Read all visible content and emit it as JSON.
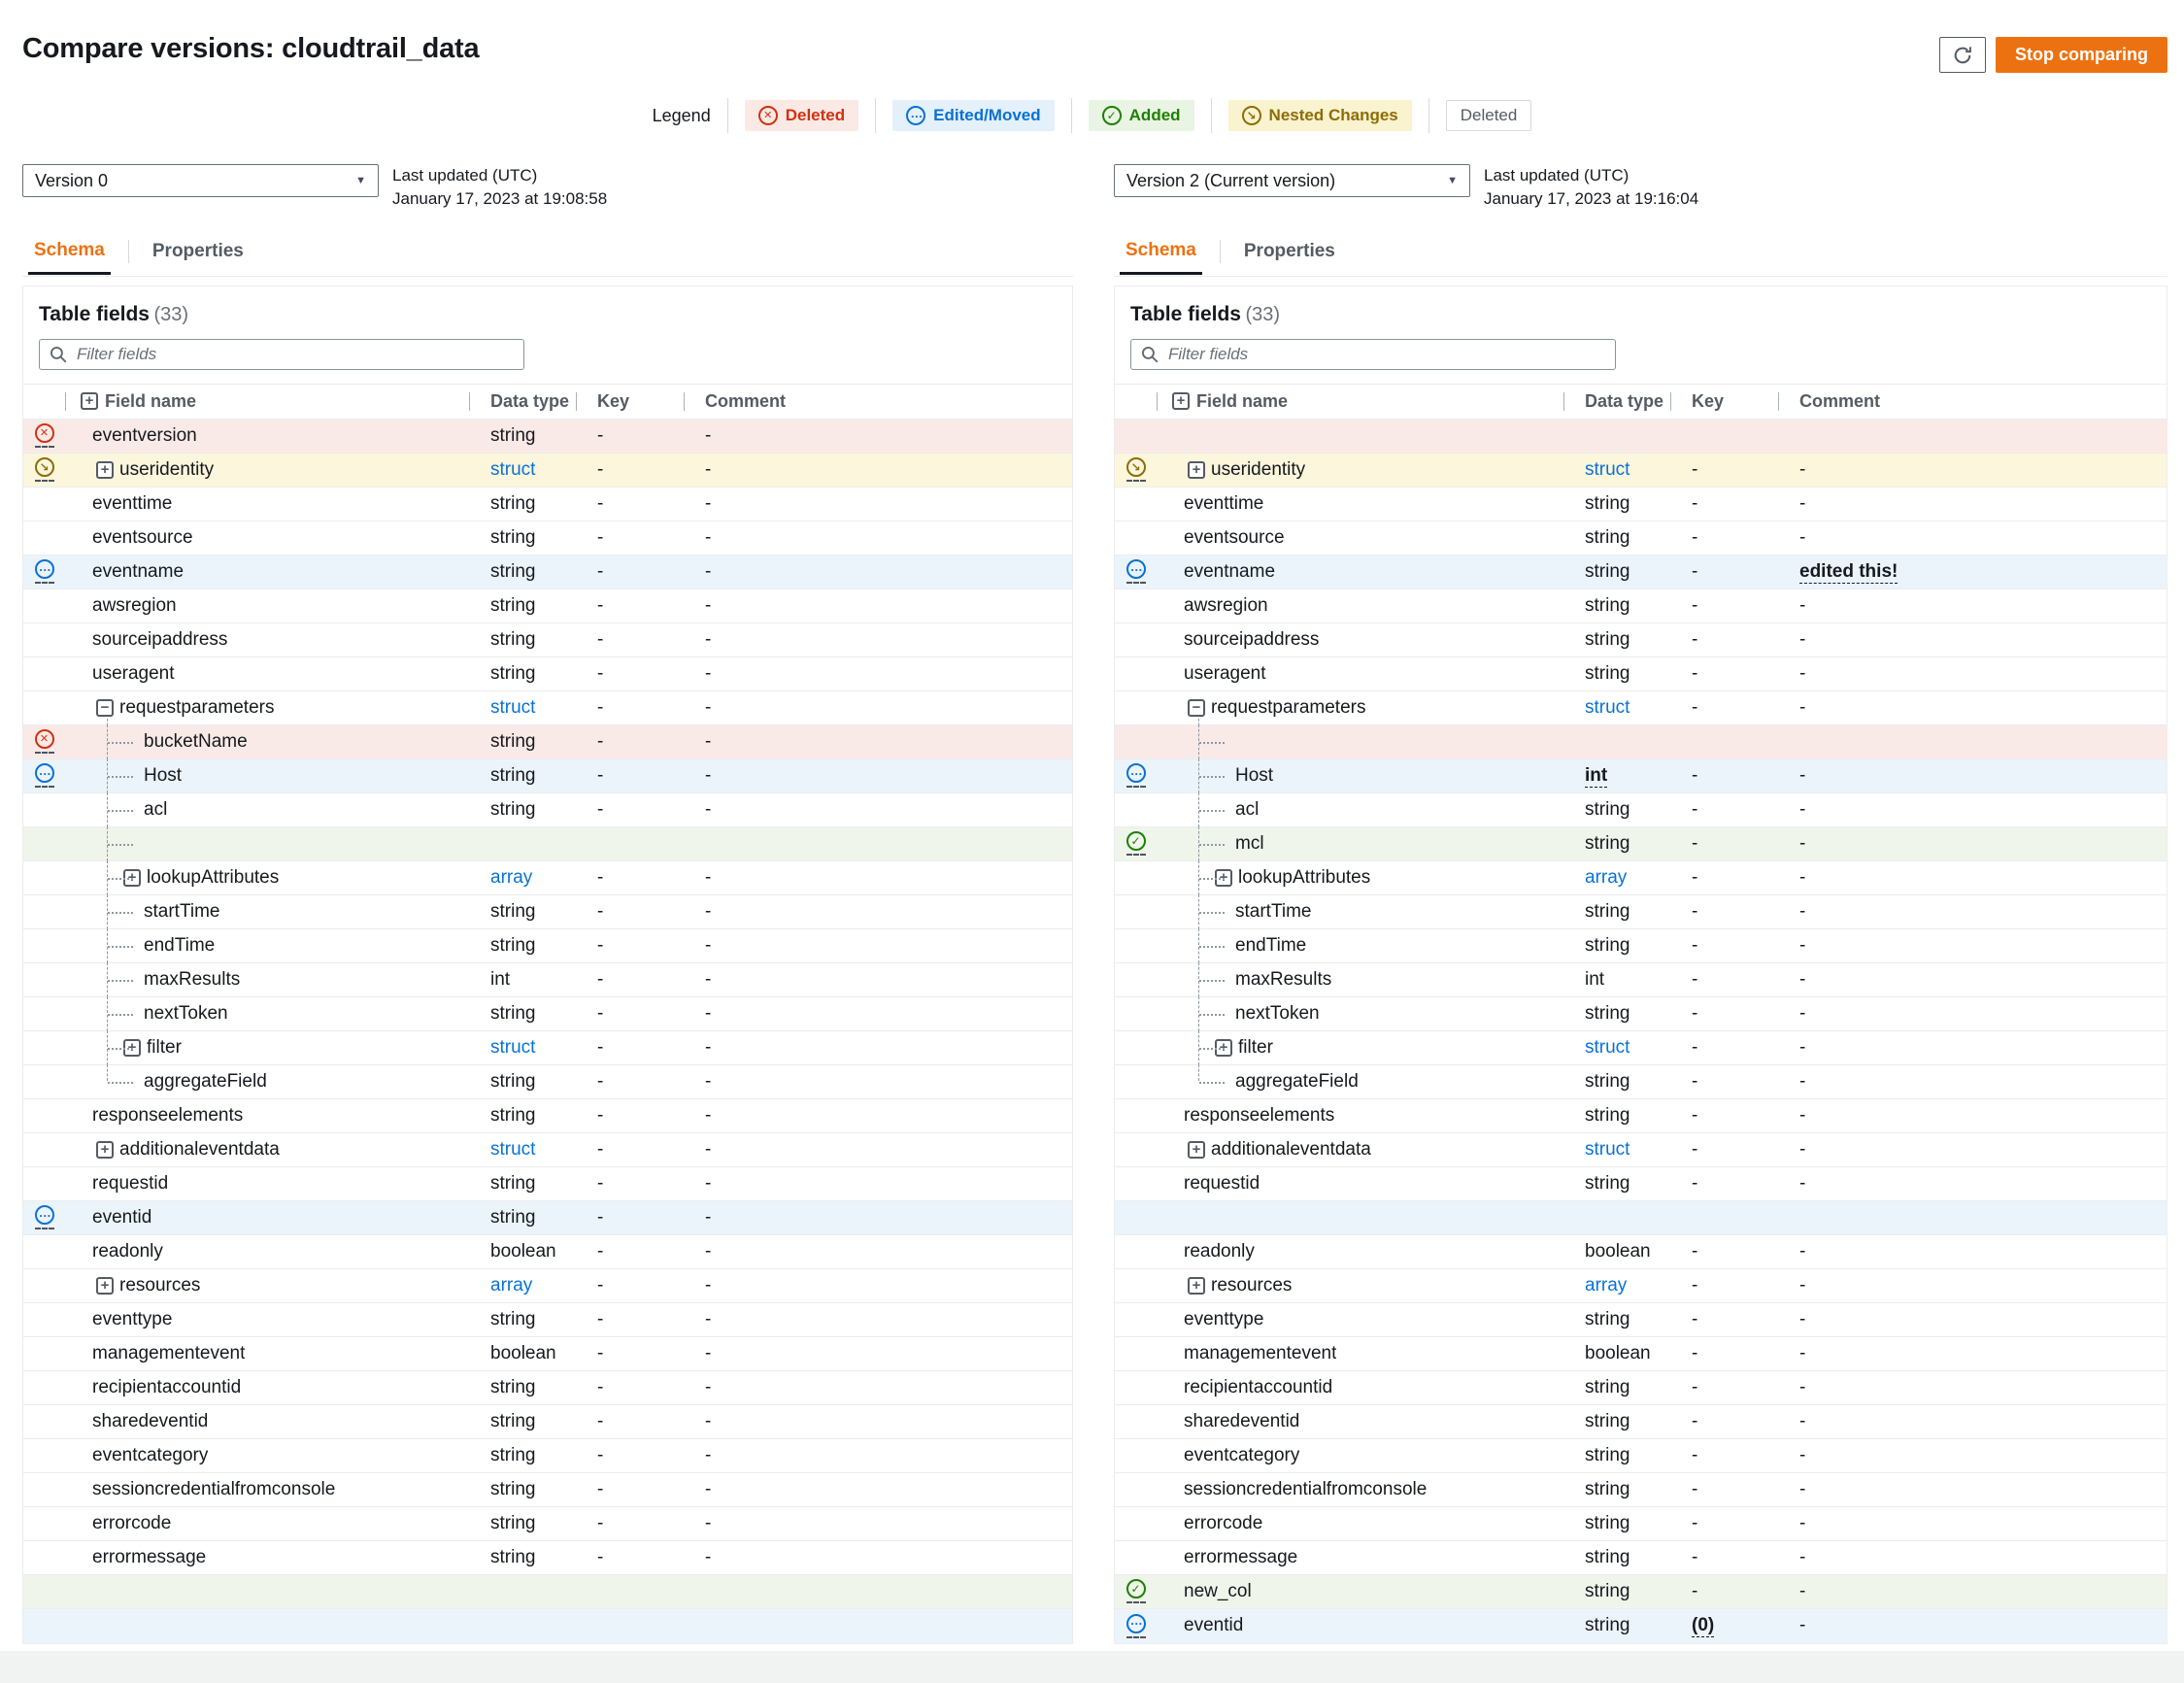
{
  "header": {
    "title": "Compare versions: cloudtrail_data",
    "refresh_icon": "refresh-icon",
    "stop_label": "Stop comparing"
  },
  "legend": {
    "label": "Legend",
    "items": [
      {
        "label": "Deleted",
        "type": "deleted"
      },
      {
        "label": "Edited/Moved",
        "type": "edited"
      },
      {
        "label": "Added",
        "type": "added"
      },
      {
        "label": "Nested Changes",
        "type": "nested"
      },
      {
        "label": "Deleted",
        "type": "plain"
      }
    ]
  },
  "status_colors": {
    "deleted": "#d13212",
    "edited": "#0972d3",
    "added": "#1d8102",
    "nested": "#8f6c08",
    "accent_orange": "#ec7211",
    "link_blue": "#0972d3"
  },
  "panels": [
    {
      "version": "Version 0",
      "last_updated_label": "Last updated (UTC)",
      "last_updated": "January 17, 2023 at 19:08:58",
      "tabs": [
        {
          "label": "Schema",
          "active": true
        },
        {
          "label": "Properties",
          "active": false
        }
      ],
      "table_title": "Table fields",
      "table_count": "(33)",
      "filter_placeholder": "Filter fields",
      "columns": [
        "Field name",
        "Data type",
        "Key",
        "Comment"
      ],
      "rows": [
        {
          "name": "eventversion",
          "type": "string",
          "key": "-",
          "comment": "-",
          "status": "deleted",
          "level": 0
        },
        {
          "name": "useridentity",
          "type": "struct",
          "key": "-",
          "comment": "-",
          "status": "nested",
          "level": 0,
          "expand": "plus"
        },
        {
          "name": "eventtime",
          "type": "string",
          "key": "-",
          "comment": "-",
          "level": 0
        },
        {
          "name": "eventsource",
          "type": "string",
          "key": "-",
          "comment": "-",
          "level": 0
        },
        {
          "name": "eventname",
          "type": "string",
          "key": "-",
          "comment": "-",
          "status": "edited",
          "level": 0
        },
        {
          "name": "awsregion",
          "type": "string",
          "key": "-",
          "comment": "-",
          "level": 0
        },
        {
          "name": "sourceipaddress",
          "type": "string",
          "key": "-",
          "comment": "-",
          "level": 0
        },
        {
          "name": "useragent",
          "type": "string",
          "key": "-",
          "comment": "-",
          "level": 0
        },
        {
          "name": "requestparameters",
          "type": "struct",
          "key": "-",
          "comment": "-",
          "level": 0,
          "expand": "minus"
        },
        {
          "name": "bucketName",
          "type": "string",
          "key": "-",
          "comment": "-",
          "status": "deleted",
          "level": 1
        },
        {
          "name": "Host",
          "type": "string",
          "key": "-",
          "comment": "-",
          "status": "edited",
          "level": 1
        },
        {
          "name": "acl",
          "type": "string",
          "key": "-",
          "comment": "-",
          "level": 1
        },
        {
          "empty": true,
          "status": "added",
          "level": 1
        },
        {
          "name": "lookupAttributes",
          "type": "array",
          "key": "-",
          "comment": "-",
          "level": 1,
          "expand": "plus"
        },
        {
          "name": "startTime",
          "type": "string",
          "key": "-",
          "comment": "-",
          "level": 1
        },
        {
          "name": "endTime",
          "type": "string",
          "key": "-",
          "comment": "-",
          "level": 1
        },
        {
          "name": "maxResults",
          "type": "int",
          "key": "-",
          "comment": "-",
          "level": 1
        },
        {
          "name": "nextToken",
          "type": "string",
          "key": "-",
          "comment": "-",
          "level": 1
        },
        {
          "name": "filter",
          "type": "struct",
          "key": "-",
          "comment": "-",
          "level": 1,
          "expand": "plus"
        },
        {
          "name": "aggregateField",
          "type": "string",
          "key": "-",
          "comment": "-",
          "level": 1
        },
        {
          "name": "responseelements",
          "type": "string",
          "key": "-",
          "comment": "-",
          "level": 0
        },
        {
          "name": "additionaleventdata",
          "type": "struct",
          "key": "-",
          "comment": "-",
          "level": 0,
          "expand": "plus"
        },
        {
          "name": "requestid",
          "type": "string",
          "key": "-",
          "comment": "-",
          "level": 0
        },
        {
          "name": "eventid",
          "type": "string",
          "key": "-",
          "comment": "-",
          "status": "edited",
          "level": 0
        },
        {
          "name": "readonly",
          "type": "boolean",
          "key": "-",
          "comment": "-",
          "level": 0
        },
        {
          "name": "resources",
          "type": "array",
          "key": "-",
          "comment": "-",
          "level": 0,
          "expand": "plus"
        },
        {
          "name": "eventtype",
          "type": "string",
          "key": "-",
          "comment": "-",
          "level": 0
        },
        {
          "name": "managementevent",
          "type": "boolean",
          "key": "-",
          "comment": "-",
          "level": 0
        },
        {
          "name": "recipientaccountid",
          "type": "string",
          "key": "-",
          "comment": "-",
          "level": 0
        },
        {
          "name": "sharedeventid",
          "type": "string",
          "key": "-",
          "comment": "-",
          "level": 0
        },
        {
          "name": "eventcategory",
          "type": "string",
          "key": "-",
          "comment": "-",
          "level": 0
        },
        {
          "name": "sessioncredentialfromconsole",
          "type": "string",
          "key": "-",
          "comment": "-",
          "level": 0
        },
        {
          "name": "errorcode",
          "type": "string",
          "key": "-",
          "comment": "-",
          "level": 0
        },
        {
          "name": "errormessage",
          "type": "string",
          "key": "-",
          "comment": "-",
          "level": 0
        },
        {
          "empty": true,
          "status": "added",
          "level": 0
        },
        {
          "empty": true,
          "status": "edited",
          "level": 0
        }
      ]
    },
    {
      "version": "Version 2 (Current version)",
      "last_updated_label": "Last updated (UTC)",
      "last_updated": "January 17, 2023 at 19:16:04",
      "tabs": [
        {
          "label": "Schema",
          "active": true
        },
        {
          "label": "Properties",
          "active": false
        }
      ],
      "table_title": "Table fields",
      "table_count": "(33)",
      "filter_placeholder": "Filter fields",
      "columns": [
        "Field name",
        "Data type",
        "Key",
        "Comment"
      ],
      "rows": [
        {
          "empty": true,
          "status": "deleted",
          "level": 0
        },
        {
          "name": "useridentity",
          "type": "struct",
          "key": "-",
          "comment": "-",
          "status": "nested",
          "level": 0,
          "expand": "plus"
        },
        {
          "name": "eventtime",
          "type": "string",
          "key": "-",
          "comment": "-",
          "level": 0
        },
        {
          "name": "eventsource",
          "type": "string",
          "key": "-",
          "comment": "-",
          "level": 0
        },
        {
          "name": "eventname",
          "type": "string",
          "key": "-",
          "comment": "edited this!",
          "comment_changed": true,
          "status": "edited",
          "level": 0
        },
        {
          "name": "awsregion",
          "type": "string",
          "key": "-",
          "comment": "-",
          "level": 0
        },
        {
          "name": "sourceipaddress",
          "type": "string",
          "key": "-",
          "comment": "-",
          "level": 0
        },
        {
          "name": "useragent",
          "type": "string",
          "key": "-",
          "comment": "-",
          "level": 0
        },
        {
          "name": "requestparameters",
          "type": "struct",
          "key": "-",
          "comment": "-",
          "level": 0,
          "expand": "minus"
        },
        {
          "empty": true,
          "status": "deleted",
          "level": 1
        },
        {
          "name": "Host",
          "type": "int",
          "type_changed": true,
          "key": "-",
          "comment": "-",
          "status": "edited",
          "level": 1
        },
        {
          "name": "acl",
          "type": "string",
          "key": "-",
          "comment": "-",
          "level": 1
        },
        {
          "name": "mcl",
          "type": "string",
          "key": "-",
          "comment": "-",
          "status": "added",
          "level": 1
        },
        {
          "name": "lookupAttributes",
          "type": "array",
          "key": "-",
          "comment": "-",
          "level": 1,
          "expand": "plus"
        },
        {
          "name": "startTime",
          "type": "string",
          "key": "-",
          "comment": "-",
          "level": 1
        },
        {
          "name": "endTime",
          "type": "string",
          "key": "-",
          "comment": "-",
          "level": 1
        },
        {
          "name": "maxResults",
          "type": "int",
          "key": "-",
          "comment": "-",
          "level": 1
        },
        {
          "name": "nextToken",
          "type": "string",
          "key": "-",
          "comment": "-",
          "level": 1
        },
        {
          "name": "filter",
          "type": "struct",
          "key": "-",
          "comment": "-",
          "level": 1,
          "expand": "plus"
        },
        {
          "name": "aggregateField",
          "type": "string",
          "key": "-",
          "comment": "-",
          "level": 1
        },
        {
          "name": "responseelements",
          "type": "string",
          "key": "-",
          "comment": "-",
          "level": 0
        },
        {
          "name": "additionaleventdata",
          "type": "struct",
          "key": "-",
          "comment": "-",
          "level": 0,
          "expand": "plus"
        },
        {
          "name": "requestid",
          "type": "string",
          "key": "-",
          "comment": "-",
          "level": 0
        },
        {
          "empty": true,
          "status": "edited",
          "level": 0
        },
        {
          "name": "readonly",
          "type": "boolean",
          "key": "-",
          "comment": "-",
          "level": 0
        },
        {
          "name": "resources",
          "type": "array",
          "key": "-",
          "comment": "-",
          "level": 0,
          "expand": "plus"
        },
        {
          "name": "eventtype",
          "type": "string",
          "key": "-",
          "comment": "-",
          "level": 0
        },
        {
          "name": "managementevent",
          "type": "boolean",
          "key": "-",
          "comment": "-",
          "level": 0
        },
        {
          "name": "recipientaccountid",
          "type": "string",
          "key": "-",
          "comment": "-",
          "level": 0
        },
        {
          "name": "sharedeventid",
          "type": "string",
          "key": "-",
          "comment": "-",
          "level": 0
        },
        {
          "name": "eventcategory",
          "type": "string",
          "key": "-",
          "comment": "-",
          "level": 0
        },
        {
          "name": "sessioncredentialfromconsole",
          "type": "string",
          "key": "-",
          "comment": "-",
          "level": 0
        },
        {
          "name": "errorcode",
          "type": "string",
          "key": "-",
          "comment": "-",
          "level": 0
        },
        {
          "name": "errormessage",
          "type": "string",
          "key": "-",
          "comment": "-",
          "level": 0
        },
        {
          "name": "new_col",
          "type": "string",
          "key": "-",
          "comment": "-",
          "status": "added",
          "level": 0
        },
        {
          "name": "eventid",
          "type": "string",
          "key": "(0)",
          "key_changed": true,
          "comment": "-",
          "status": "edited",
          "level": 0
        }
      ]
    }
  ]
}
